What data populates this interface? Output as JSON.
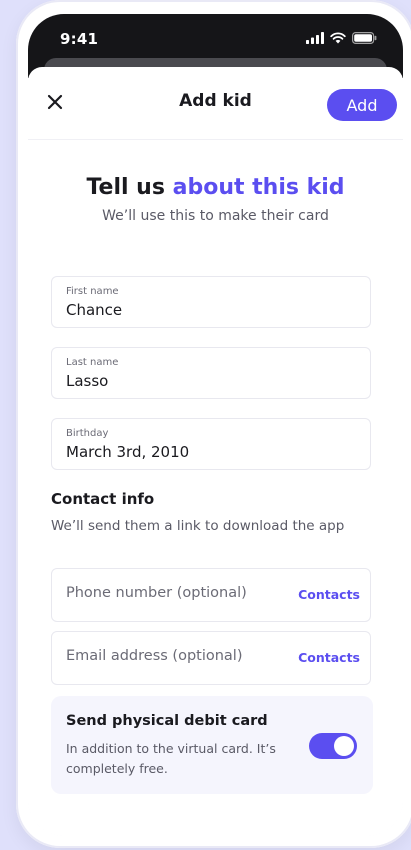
{
  "status": {
    "time": "9:41",
    "icons": [
      "signal-icon",
      "wifi-icon",
      "battery-icon"
    ]
  },
  "nav": {
    "title": "Add kid",
    "add_label": "Add",
    "close_icon": "close-icon"
  },
  "intro": {
    "headline_plain": "Tell us ",
    "headline_accent": "about this kid",
    "subhead": "We’ll use this to make their card"
  },
  "fields": {
    "first_name": {
      "label": "First name",
      "value": "Chance"
    },
    "last_name": {
      "label": "Last name",
      "value": "Lasso"
    },
    "birthday": {
      "label": "Birthday",
      "value": "March 3rd, 2010"
    }
  },
  "contact": {
    "title": "Contact info",
    "subtitle": "We’ll send them a link to download the app",
    "phone": {
      "placeholder": "Phone number (optional)",
      "action": "Contacts"
    },
    "email": {
      "placeholder": "Email address (optional)",
      "action": "Contacts"
    }
  },
  "debit_card": {
    "title": "Send physical debit card",
    "description": "In addition to the virtual card. It’s completely free.",
    "enabled": true
  },
  "colors": {
    "accent": "#5b4ef0",
    "background": "#dfe0fb",
    "text": "#1a1a1f"
  }
}
